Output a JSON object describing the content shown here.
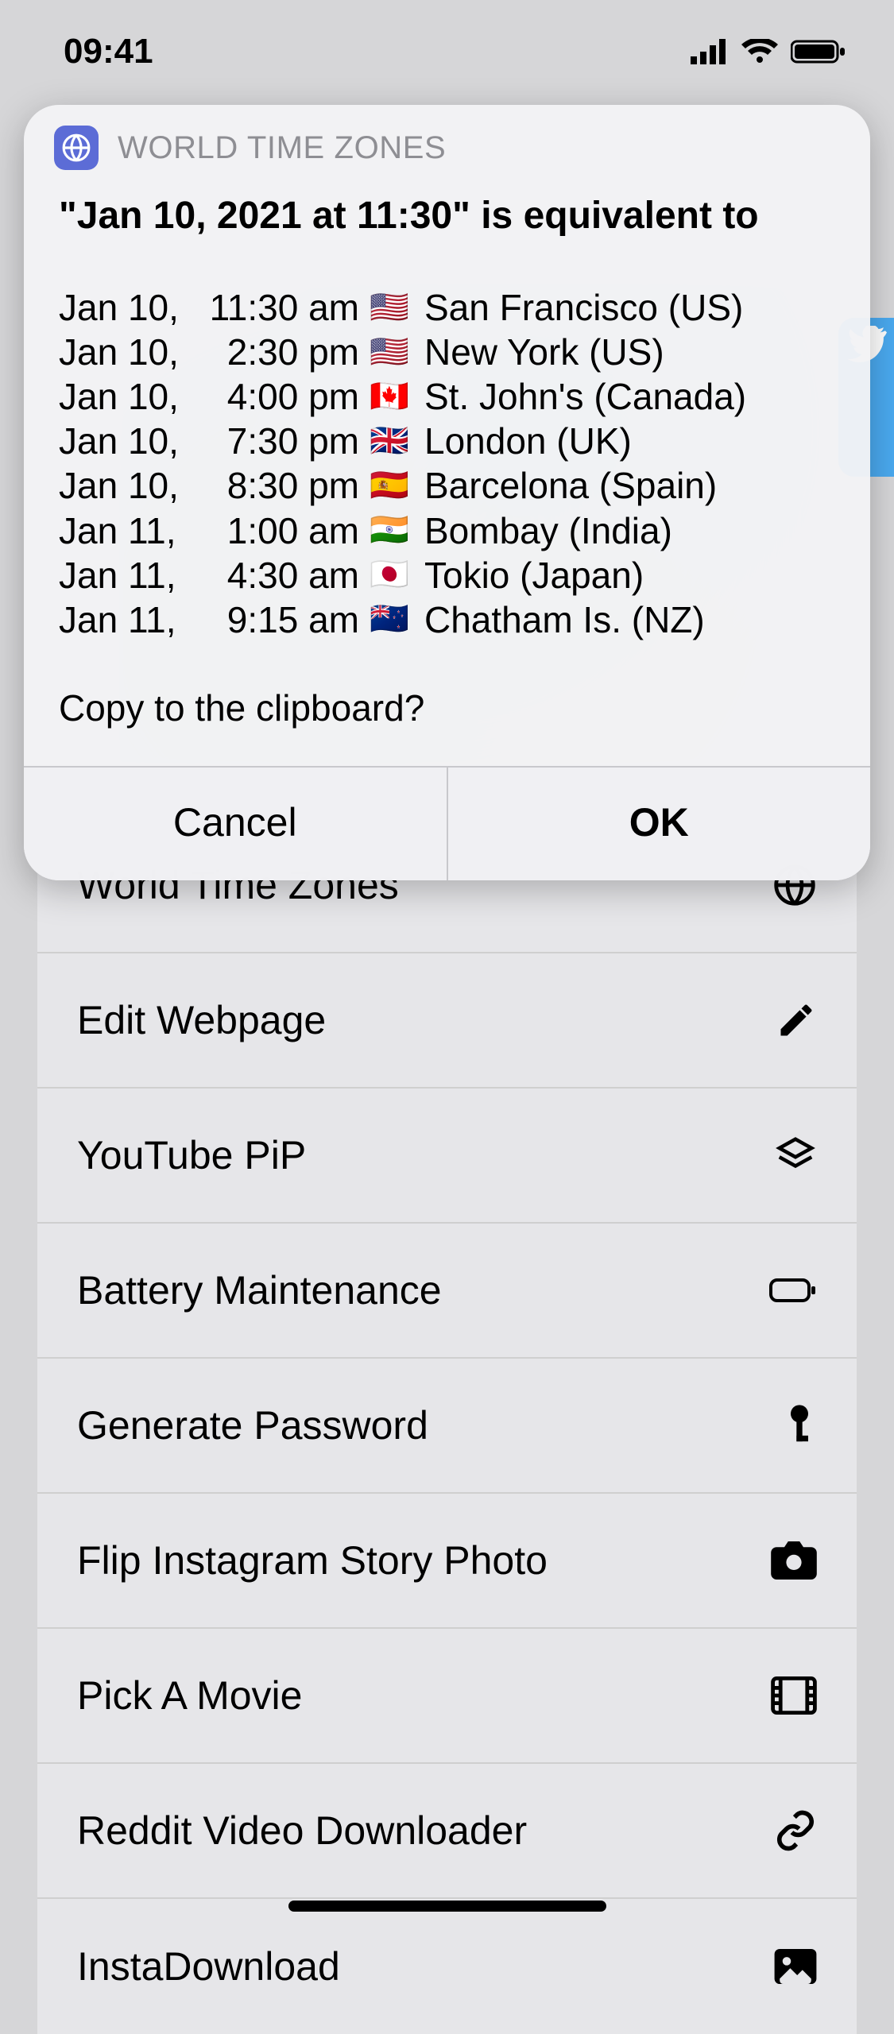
{
  "status": {
    "time": "09:41"
  },
  "alert": {
    "app_name": "WORLD TIME ZONES",
    "title": "\"Jan 10, 2021 at 11:30\" is equivalent to",
    "rows": [
      {
        "date": "Jan 10,",
        "time": "11:30 am",
        "flag": "🇺🇸",
        "city": "San Francisco (US)"
      },
      {
        "date": "Jan 10,",
        "time": "2:30 pm",
        "flag": "🇺🇸",
        "city": "New York (US)"
      },
      {
        "date": "Jan 10,",
        "time": "4:00 pm",
        "flag": "🇨🇦",
        "city": "St. John's (Canada)"
      },
      {
        "date": "Jan 10,",
        "time": "7:30 pm",
        "flag": "🇬🇧",
        "city": "London (UK)"
      },
      {
        "date": "Jan 10,",
        "time": "8:30 pm",
        "flag": "🇪🇸",
        "city": "Barcelona (Spain)"
      },
      {
        "date": "Jan 11,",
        "time": "1:00 am",
        "flag": "🇮🇳",
        "city": "Bombay (India)"
      },
      {
        "date": "Jan 11,",
        "time": "4:30 am",
        "flag": "🇯🇵",
        "city": "Tokio (Japan)"
      },
      {
        "date": "Jan 11,",
        "time": "9:15 am",
        "flag": "🇳🇿",
        "city": "Chatham Is. (NZ)"
      }
    ],
    "copy_prompt": "Copy to the clipboard?",
    "cancel_label": "Cancel",
    "ok_label": "OK"
  },
  "shortcuts": [
    {
      "label": "World Time Zones",
      "icon": "globe-icon"
    },
    {
      "label": "Edit Webpage",
      "icon": "pencil-icon"
    },
    {
      "label": "YouTube PiP",
      "icon": "layers-icon"
    },
    {
      "label": "Battery Maintenance",
      "icon": "battery-icon"
    },
    {
      "label": "Generate Password",
      "icon": "key-icon"
    },
    {
      "label": "Flip Instagram Story Photo",
      "icon": "camera-icon"
    },
    {
      "label": "Pick A Movie",
      "icon": "film-icon"
    },
    {
      "label": "Reddit Video Downloader",
      "icon": "link-icon"
    },
    {
      "label": "InstaDownload",
      "icon": "image-icon"
    }
  ]
}
